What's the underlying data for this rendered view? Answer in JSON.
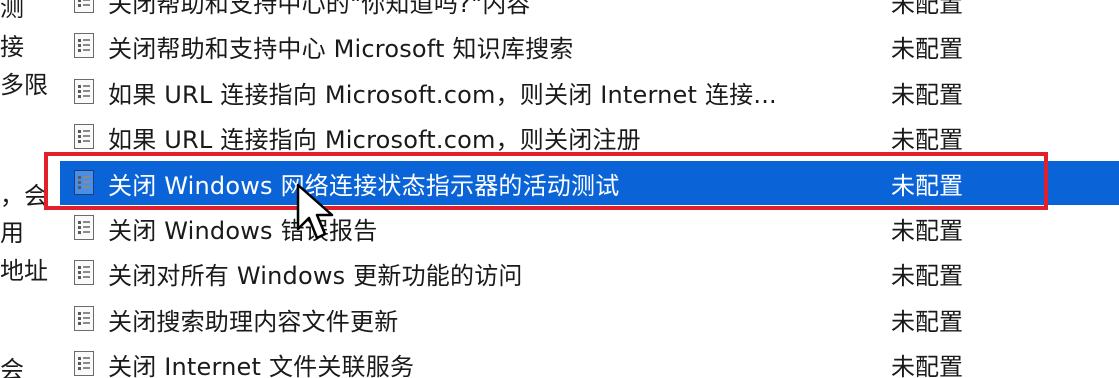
{
  "left_pane": {
    "lines": [
      "测",
      "接",
      "多限",
      "，会",
      "用",
      "地址",
      "会"
    ]
  },
  "policies": [
    {
      "name": "关闭帮助和支持中心的\"你知道吗?\"内容",
      "state": "未配置"
    },
    {
      "name": "关闭帮助和支持中心 Microsoft 知识库搜索",
      "state": "未配置"
    },
    {
      "name": "如果 URL 连接指向 Microsoft.com，则关闭 Internet 连接...",
      "state": "未配置"
    },
    {
      "name": "如果 URL 连接指向 Microsoft.com，则关闭注册",
      "state": "未配置"
    },
    {
      "name": "关闭 Windows 网络连接状态指示器的活动测试",
      "state": "未配置"
    },
    {
      "name": "关闭 Windows 错误报告",
      "state": "未配置"
    },
    {
      "name": "关闭对所有 Windows 更新功能的访问",
      "state": "未配置"
    },
    {
      "name": "关闭搜索助理内容文件更新",
      "state": "未配置"
    },
    {
      "name": "关闭 Internet 文件关联服务",
      "state": "未配置"
    }
  ],
  "selected_index": 4,
  "colors": {
    "selection": "#0a64d8",
    "highlight_border": "#e0212b",
    "text": "#1a1a1a"
  },
  "icons": {
    "policy": "policy-setting-icon",
    "pointer": "mouse-pointer-icon"
  }
}
